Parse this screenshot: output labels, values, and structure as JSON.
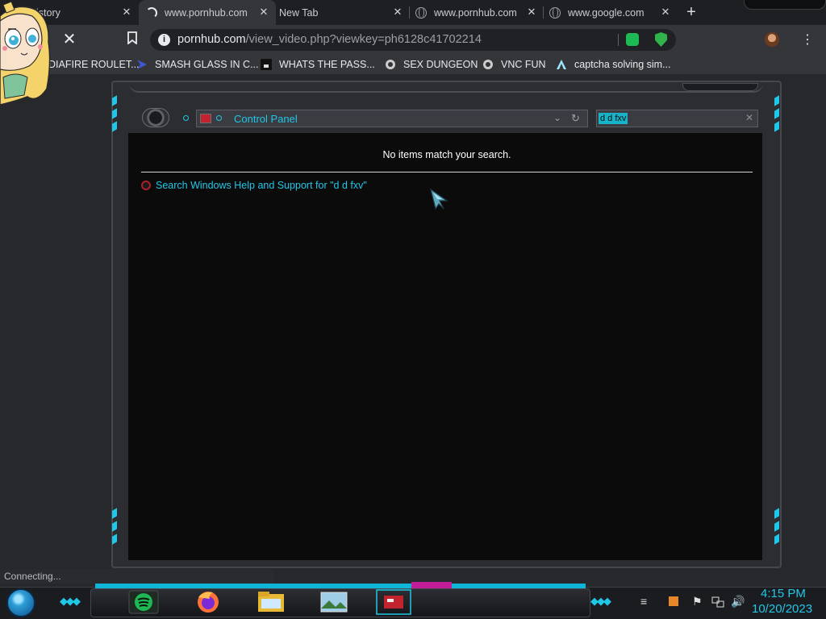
{
  "browser": {
    "tabs": [
      {
        "title": "History",
        "close": "✕"
      },
      {
        "title": "www.pornhub.com",
        "close": "✕"
      },
      {
        "title": "New Tab",
        "close": "✕"
      },
      {
        "title": "www.pornhub.com",
        "close": "✕"
      },
      {
        "title": "www.google.com",
        "close": "✕"
      }
    ],
    "new_tab": "+",
    "url_host": "pornhub.com",
    "url_path": "/view_video.php?viewkey=ph6128c41702214",
    "info_glyph": "i",
    "stop_glyph": "✕",
    "back_glyph": "›",
    "bookmark_glyph": "🔖",
    "menu_glyph": "⋮"
  },
  "bookmarks": [
    {
      "label": "DIAFIRE ROULET...",
      "icon": "diafire-icon"
    },
    {
      "label": "SMASH GLASS IN C...",
      "icon": "smash-icon"
    },
    {
      "label": "WHATS THE PASS...",
      "icon": "pass-icon"
    },
    {
      "label": "SEX DUNGEON",
      "icon": "dungeon-icon"
    },
    {
      "label": "VNC FUN",
      "icon": "vnc-icon"
    },
    {
      "label": "captcha solving sim...",
      "icon": "captcha-icon"
    }
  ],
  "explorer": {
    "address": "Control Panel",
    "search_value": "d d fxv",
    "no_items": "No items match your search.",
    "help_link": "Search Windows Help and Support for \"d d fxv\"",
    "chevron": "⌄",
    "refresh": "↻",
    "clear": "✕"
  },
  "status": {
    "text": "Connecting..."
  },
  "taskbar": {
    "time": "4:15 PM",
    "date": "10/20/2023",
    "apps": [
      "spotify-icon",
      "firefox-icon",
      "explorer-icon",
      "photos-icon",
      "control-panel-icon"
    ]
  },
  "colors": {
    "accent": "#21c7e8",
    "browser_bg": "#35363a",
    "content_bg": "#0b0b0c"
  }
}
